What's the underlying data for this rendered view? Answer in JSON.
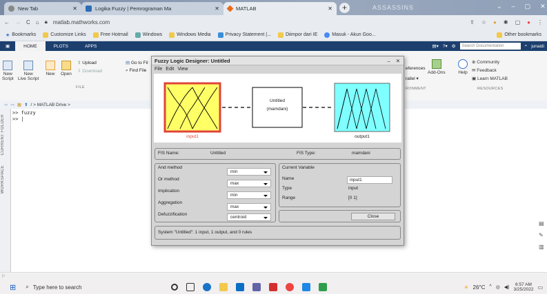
{
  "browser": {
    "tabs": [
      {
        "label": "New Tab",
        "active": false
      },
      {
        "label": "Logika Fuzzy | Pemrograman Ma",
        "active": false
      },
      {
        "label": "MATLAB",
        "active": true
      }
    ],
    "theme_label": "ASSASSINS",
    "url": "matlab.mathworks.com",
    "bookmarks": [
      "Bookmarks",
      "Customize Links",
      "Free Hotmail",
      "Windows",
      "Windows Media",
      "Privacy Statement |...",
      "Diimpor dari IE",
      "Masuk - Akun Goo...",
      "Other bookmarks"
    ]
  },
  "matlab": {
    "tabs": [
      "HOME",
      "PLOTS",
      "APPS"
    ],
    "toolstrip": {
      "new_script": "New\nScript",
      "new_live_script": "New\nLive Script",
      "new": "New",
      "open": "Open",
      "upload": "Upload",
      "download": "Download",
      "goto": "Go to Fil",
      "find_file": "Find File",
      "file_section": "FILE",
      "preferences": "eferences",
      "parallel": "rallel",
      "addons": "Add-Ons",
      "help": "Help",
      "community": "Community",
      "feedback": "Feedback",
      "learn": "Learn MATLAB",
      "env_section": "RONMENT",
      "resources_section": "RESOURCES",
      "search_placeholder": "Search Documentation",
      "user": "junaidi"
    },
    "path": "/ > MATLAB Drive >",
    "sidebar": [
      "CURRENT FOLDER",
      "WORKSPACE"
    ],
    "command_lines": [
      ">> fuzzy",
      ">> |"
    ]
  },
  "dialog": {
    "title": "Fuzzy Logic Designer: Untitled",
    "menu": [
      "File",
      "Edit",
      "View"
    ],
    "input_label": "input1",
    "center_name": "Untitled",
    "center_type": "(mamdani)",
    "output_label": "output1",
    "fis_name_label": "FIS Name:",
    "fis_name_value": "Untitled",
    "fis_type_label": "FIS Type:",
    "fis_type_value": "mamdani",
    "methods": [
      {
        "label": "And method",
        "value": "min"
      },
      {
        "label": "Or method",
        "value": "max"
      },
      {
        "label": "Implication",
        "value": "min"
      },
      {
        "label": "Aggregation",
        "value": "max"
      },
      {
        "label": "Defuzzification",
        "value": "centroid"
      }
    ],
    "current_variable_label": "Current Variable",
    "name_label": "Name",
    "name_value": "input1",
    "type_label": "Type",
    "type_value": "input",
    "range_label": "Range",
    "range_value": "[0 1]",
    "close_label": "Close",
    "status": "System \"Untitled\": 1 input, 1 output, and 0 rules"
  },
  "taskbar": {
    "search_placeholder": "Type here to search",
    "weather": "26°C",
    "time": "6:57 AM",
    "date": "3/25/2022"
  },
  "colors": {
    "input_fill": "#ffff66",
    "input_border": "#e0433a",
    "output_fill": "#7fffff",
    "matlab_header": "#1c3f6e"
  }
}
